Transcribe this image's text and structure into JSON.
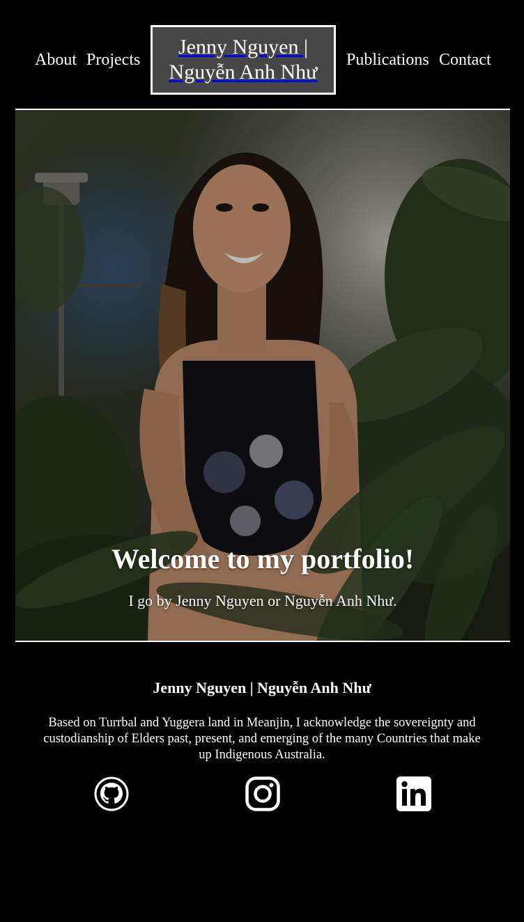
{
  "nav": {
    "about": "About",
    "projects": "Projects",
    "brand_line1": "Jenny Nguyen |",
    "brand_line2": "Nguyễn Anh Như",
    "publications": "Publications",
    "contact": "Contact"
  },
  "hero": {
    "title": "Welcome to my portfolio!",
    "subtitle": "I go by Jenny Nguyen or Nguyễn Anh Như."
  },
  "footer": {
    "name": "Jenny Nguyen | Nguyễn Anh Như",
    "acknowledgement": "Based on Turrbal and Yuggera land in Meanjin, I acknowledge the sovereignty and custodianship of Elders past, present, and emerging of the many Countries that make up Indigenous Australia.",
    "social": [
      {
        "icon": "github-icon"
      },
      {
        "icon": "instagram-icon"
      },
      {
        "icon": "linkedin-icon"
      }
    ]
  },
  "colors": {
    "background": "#000000",
    "text": "#ffffff",
    "brand_box": "#464646"
  }
}
